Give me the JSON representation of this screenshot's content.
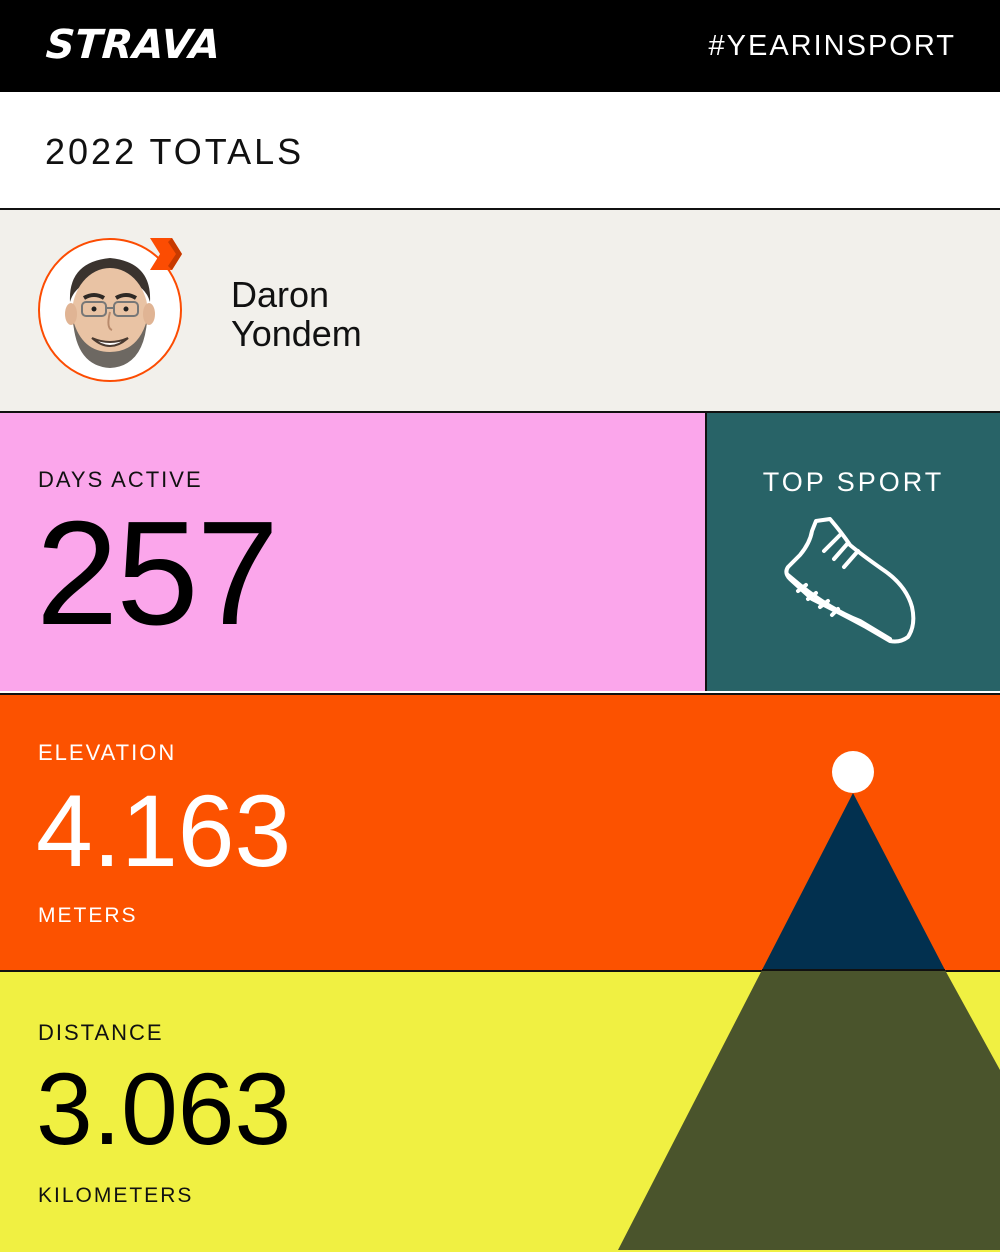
{
  "header": {
    "brand": "STRAVA",
    "hashtag": "#YEARINSPORT"
  },
  "title": "2022 TOTALS",
  "profile": {
    "first_name": "Daron",
    "last_name": "Yondem",
    "avatar_icon": "avatar-caricature",
    "badge_icon": "strava-chevron-badge"
  },
  "stats": {
    "days_active": {
      "label": "DAYS ACTIVE",
      "value": "257"
    },
    "top_sport": {
      "label": "TOP SPORT",
      "icon": "running-shoe-icon"
    },
    "elevation": {
      "label": "ELEVATION",
      "value": "4.163",
      "unit": "METERS"
    },
    "distance": {
      "label": "DISTANCE",
      "value": "3.063",
      "unit": "KILOMETERS"
    }
  },
  "colors": {
    "header_bg": "#000000",
    "profile_bg": "#f2f0eb",
    "days_bg": "#fba6eb",
    "sport_bg": "#286367",
    "elevation_bg": "#fc5200",
    "distance_bg": "#f0f042",
    "mountain_peak": "#02304f",
    "mountain_base": "#4a542c"
  }
}
